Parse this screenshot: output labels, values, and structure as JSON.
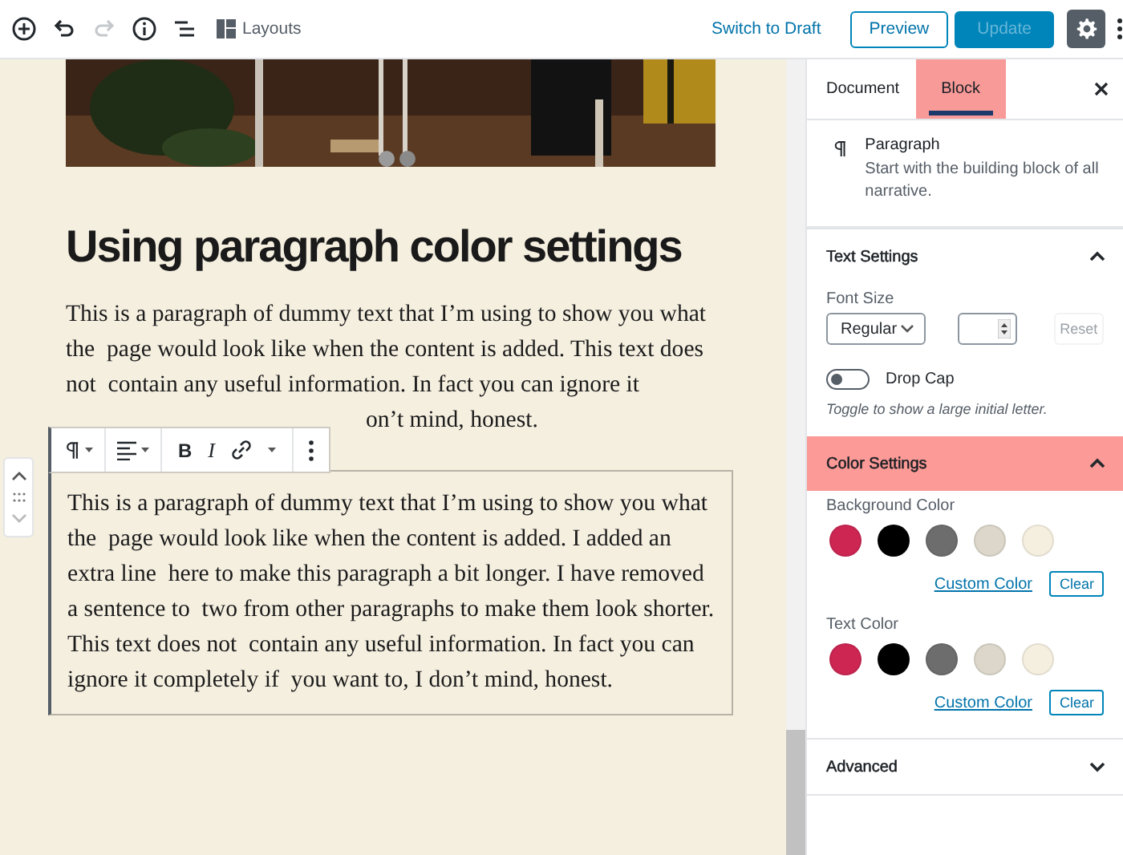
{
  "top_bar": {
    "tools": [
      {
        "kind": "add",
        "disabled": false
      },
      {
        "kind": "undo",
        "disabled": false
      },
      {
        "kind": "redo",
        "disabled": true
      },
      {
        "kind": "info",
        "disabled": false
      },
      {
        "kind": "outline",
        "disabled": false
      }
    ],
    "layouts": "Layouts",
    "switch_to_draft": "Switch to Draft",
    "preview": "Preview",
    "update": {
      "label": "Update",
      "disabled": true
    },
    "settings": {
      "selected": true
    }
  },
  "editor": {
    "heading": "Using paragraph color settings",
    "paragraphs": [
      {
        "text": "This is a paragraph of dummy text that I’m using to show you what the  page would look like when the content is added. This text does not  contain any useful information. In fact you can ignore it",
        "tail": "on’t mind, honest.",
        "selected": false
      },
      {
        "text": "This is a paragraph of dummy text that I’m using to show you what the  page would look like when the content is added. I added an extra line  here to make this paragraph a bit longer. I have removed a sentence to  two from other paragraphs to make them look shorter. This text does not  contain any useful information. In fact you can ignore it completely if  you want to, I don’t mind, honest.",
        "selected": true
      }
    ],
    "block_toolbar": {
      "format_buttons": [
        "B",
        "I"
      ]
    }
  },
  "sidebar": {
    "tabs": [
      {
        "label": "Document",
        "selected": false,
        "highlighted": false
      },
      {
        "label": "Block",
        "selected": true,
        "highlighted": true
      }
    ],
    "block_card": {
      "title": "Paragraph",
      "description": "Start with the building block of all narrative."
    },
    "panels": [
      {
        "kind": "text_settings",
        "title": "Text Settings",
        "expanded": true,
        "highlighted": false,
        "font_size_label": "Font Size",
        "font_size": "Regular",
        "reset": {
          "label": "Reset",
          "disabled": true
        },
        "drop_cap": {
          "label": "Drop Cap",
          "on": false,
          "help": "Toggle to show a large initial letter."
        }
      },
      {
        "kind": "color_settings",
        "title": "Color Settings",
        "expanded": true,
        "highlighted": true,
        "groups": [
          {
            "label": "Background Color",
            "swatches": [
              {
                "color": "#cd2653"
              },
              {
                "color": "#000000"
              },
              {
                "color": "#6d6d6d"
              },
              {
                "color": "#dcd7ca"
              },
              {
                "color": "#f5efe0"
              }
            ],
            "custom": "Custom Color",
            "clear": "Clear"
          },
          {
            "label": "Text Color",
            "swatches": [
              {
                "color": "#cd2653"
              },
              {
                "color": "#000000"
              },
              {
                "color": "#6d6d6d"
              },
              {
                "color": "#dcd7ca"
              },
              {
                "color": "#f5efe0"
              }
            ],
            "custom": "Custom Color",
            "clear": "Clear"
          }
        ]
      },
      {
        "kind": "advanced",
        "title": "Advanced",
        "expanded": false,
        "highlighted": false
      }
    ]
  }
}
